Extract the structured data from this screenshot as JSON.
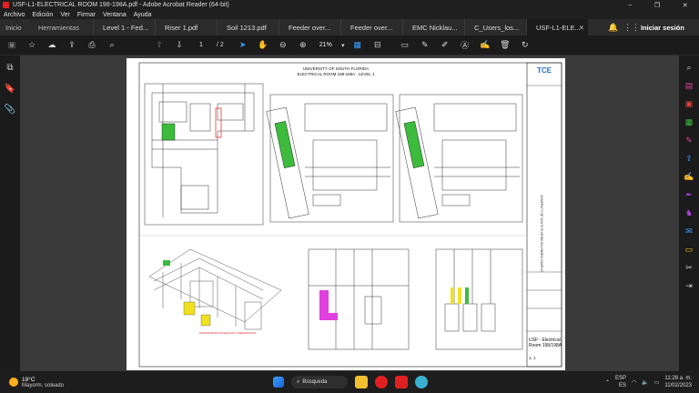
{
  "window": {
    "title": "USF-L1-ELECTRICAL ROOM 198-198A.pdf - Adobe Acrobat Reader (64-bit)",
    "controls": [
      "–",
      "❐",
      "✕"
    ]
  },
  "menu": [
    "Archivo",
    "Edición",
    "Ver",
    "Firmar",
    "Ventana",
    "Ayuda"
  ],
  "tabs": {
    "home": "Inicio",
    "tools": "Herramientas",
    "documents": [
      {
        "label": "Level 1 - Fed..."
      },
      {
        "label": "Riser 1.pdf"
      },
      {
        "label": "Soil 1213.pdf"
      },
      {
        "label": "Feeder over..."
      },
      {
        "label": "Feeder over..."
      },
      {
        "label": "EMC Nicklau..."
      },
      {
        "label": "C_Users_los..."
      },
      {
        "label": "USF-L1-ELE..."
      }
    ],
    "active_index": 7,
    "close_glyph": "✕",
    "sign_in": "Iniciar sesión"
  },
  "toolbar": {
    "page_current": "1",
    "page_total": "/ 2",
    "zoom": "21%"
  },
  "drawing": {
    "title_line1": "UNIVERSITY OF SOUTH FLORIDA",
    "title_line2": "ELECTRICAL ROOM 198-198A - LEVEL 1",
    "logo": "TCE",
    "sheet_title": "USF - Electrical Room 198/198A",
    "sheet_number": "1, 1",
    "vertical_text": "UNIVERSITY OF SOUTH FLORIDA HILLSBORO CAMPUS",
    "callout": "PROVIDE BEAM HANGERS WITH THREADED ROD"
  },
  "taskbar": {
    "temperature": "19°C",
    "weather": "Mayorm. soleado",
    "search": "Búsqueda",
    "lang1": "ESP",
    "lang2": "ES",
    "time": "11:28 a. m.",
    "date": "11/02/2023"
  },
  "colors": {
    "accent": "#3aa0ff",
    "pdf_red": "#e02020",
    "drawing_green": "#3dbb3d",
    "drawing_magenta": "#e040e0",
    "drawing_yellow": "#f0e020"
  }
}
